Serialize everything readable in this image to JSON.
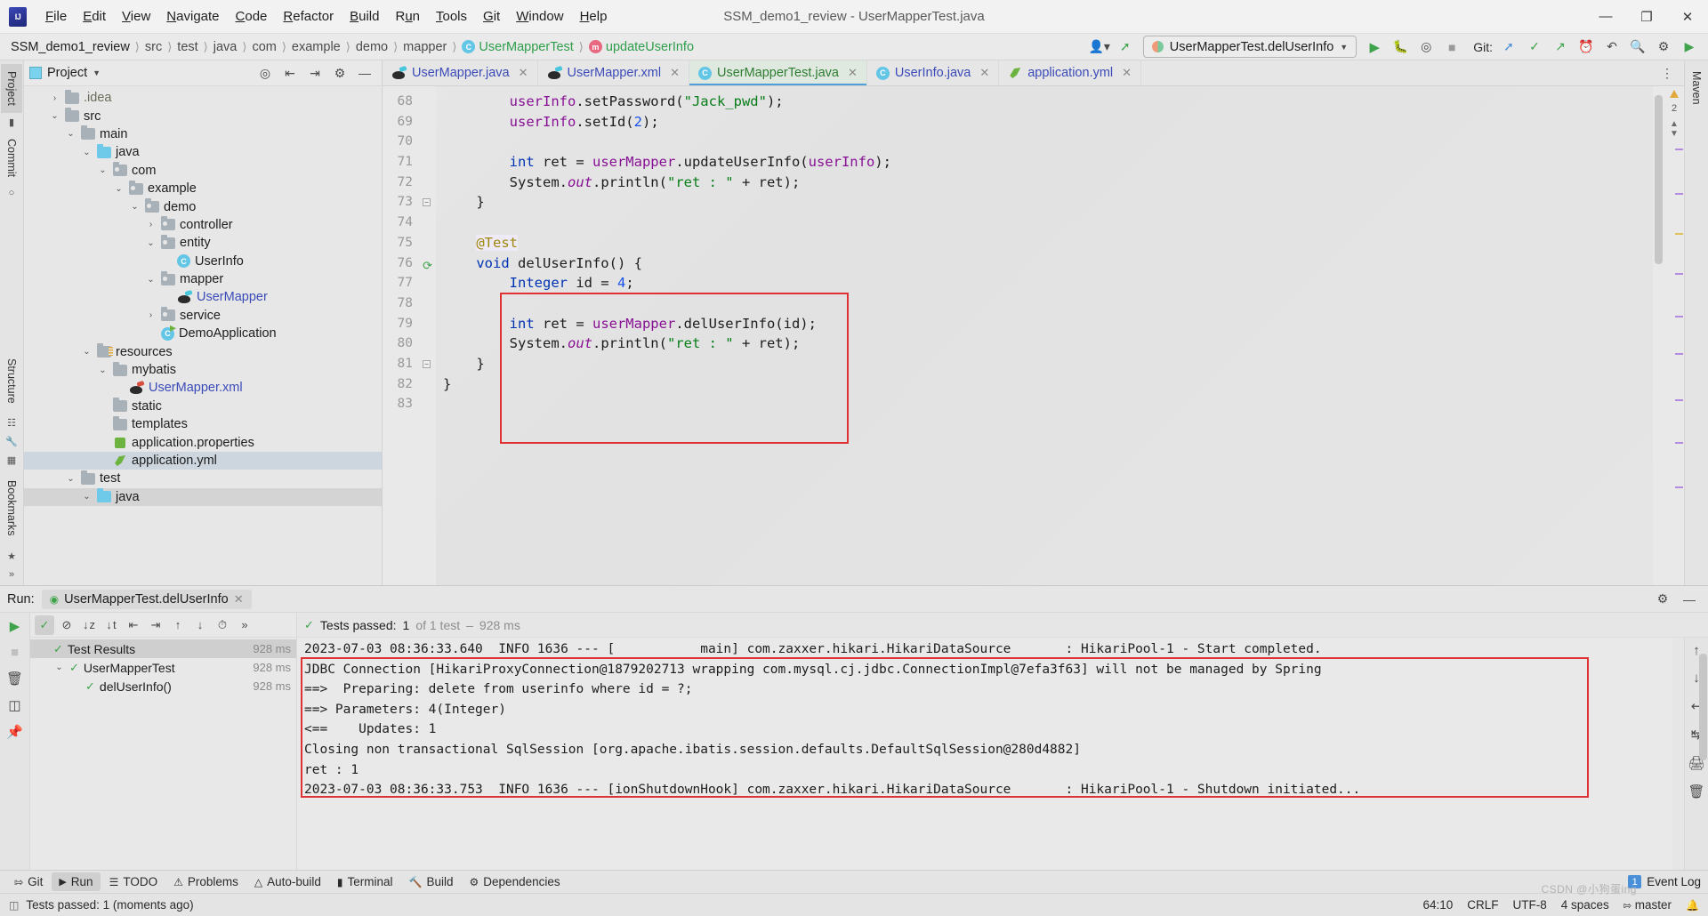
{
  "window": {
    "title": "SSM_demo1_review - UserMapperTest.java",
    "minimize": "—",
    "maximize": "❐",
    "close": "✕"
  },
  "menu": {
    "items": [
      "File",
      "Edit",
      "View",
      "Navigate",
      "Code",
      "Refactor",
      "Build",
      "Run",
      "Tools",
      "Git",
      "Window",
      "Help"
    ]
  },
  "breadcrumb": {
    "items": [
      {
        "label": "SSM_demo1_review",
        "type": "project"
      },
      {
        "label": "src",
        "type": "dir"
      },
      {
        "label": "test",
        "type": "dir"
      },
      {
        "label": "java",
        "type": "dir"
      },
      {
        "label": "com",
        "type": "dir"
      },
      {
        "label": "example",
        "type": "dir"
      },
      {
        "label": "demo",
        "type": "dir"
      },
      {
        "label": "mapper",
        "type": "dir"
      },
      {
        "label": "UserMapperTest",
        "type": "class"
      },
      {
        "label": "updateUserInfo",
        "type": "method"
      }
    ]
  },
  "toolbar": {
    "run_config": "UserMapperTest.delUserInfo",
    "git_label": "Git:",
    "icons": {
      "profile": "person-icon",
      "updown": "arrow-icon",
      "run": "run-icon",
      "debug": "debug-icon",
      "coverage": "coverage-icon",
      "stop": "stop-icon",
      "commit": "commit-icon",
      "check": "check-icon",
      "push": "push-icon",
      "history": "history-icon",
      "undo": "undo-icon",
      "search": "search-icon",
      "settings": "settings-icon"
    }
  },
  "left_rail": {
    "tabs": [
      "Project",
      "Commit"
    ],
    "bottom": [
      "Structure",
      "Bookmarks"
    ]
  },
  "project_panel": {
    "title": "Project",
    "tree": [
      {
        "label": ".idea",
        "depth": 1,
        "twisty": "›",
        "icon": "folder",
        "style": "dim"
      },
      {
        "label": "src",
        "depth": 1,
        "twisty": "⌄",
        "icon": "folder",
        "style": ""
      },
      {
        "label": "main",
        "depth": 2,
        "twisty": "⌄",
        "icon": "folder",
        "style": ""
      },
      {
        "label": "java",
        "depth": 3,
        "twisty": "⌄",
        "icon": "folder-blue",
        "style": ""
      },
      {
        "label": "com",
        "depth": 4,
        "twisty": "⌄",
        "icon": "folder-pkg",
        "style": ""
      },
      {
        "label": "example",
        "depth": 5,
        "twisty": "⌄",
        "icon": "folder-pkg",
        "style": ""
      },
      {
        "label": "demo",
        "depth": 6,
        "twisty": "⌄",
        "icon": "folder-pkg",
        "style": ""
      },
      {
        "label": "controller",
        "depth": 7,
        "twisty": "›",
        "icon": "folder-pkg",
        "style": ""
      },
      {
        "label": "entity",
        "depth": 7,
        "twisty": "⌄",
        "icon": "folder-pkg",
        "style": ""
      },
      {
        "label": "UserInfo",
        "depth": 8,
        "twisty": "",
        "icon": "class",
        "style": ""
      },
      {
        "label": "mapper",
        "depth": 7,
        "twisty": "⌄",
        "icon": "folder-pkg",
        "style": ""
      },
      {
        "label": "UserMapper",
        "depth": 8,
        "twisty": "",
        "icon": "mybatis",
        "style": "link"
      },
      {
        "label": "service",
        "depth": 7,
        "twisty": "›",
        "icon": "folder-pkg",
        "style": ""
      },
      {
        "label": "DemoApplication",
        "depth": 7,
        "twisty": "",
        "icon": "spring-class",
        "style": ""
      },
      {
        "label": "resources",
        "depth": 3,
        "twisty": "⌄",
        "icon": "folder-res",
        "style": ""
      },
      {
        "label": "mybatis",
        "depth": 4,
        "twisty": "⌄",
        "icon": "folder",
        "style": ""
      },
      {
        "label": "UserMapper.xml",
        "depth": 5,
        "twisty": "",
        "icon": "mybatis-red",
        "style": "link"
      },
      {
        "label": "static",
        "depth": 4,
        "twisty": "",
        "icon": "folder",
        "style": ""
      },
      {
        "label": "templates",
        "depth": 4,
        "twisty": "",
        "icon": "folder",
        "style": ""
      },
      {
        "label": "application.properties",
        "depth": 4,
        "twisty": "",
        "icon": "props",
        "style": ""
      },
      {
        "label": "application.yml",
        "depth": 4,
        "twisty": "",
        "icon": "yml",
        "style": "selected"
      },
      {
        "label": "test",
        "depth": 2,
        "twisty": "⌄",
        "icon": "folder",
        "style": ""
      },
      {
        "label": "java",
        "depth": 3,
        "twisty": "⌄",
        "icon": "folder-blue",
        "style": "selected2"
      }
    ]
  },
  "editor": {
    "tabs": [
      {
        "label": "UserMapper.java",
        "icon": "mybatis-icon",
        "active": false
      },
      {
        "label": "UserMapper.xml",
        "icon": "mybatis-icon",
        "active": false
      },
      {
        "label": "UserMapperTest.java",
        "icon": "class-icon",
        "active": true
      },
      {
        "label": "UserInfo.java",
        "icon": "class-icon",
        "active": false
      },
      {
        "label": "application.yml",
        "icon": "yml-icon",
        "active": false
      }
    ],
    "warning_count": "2",
    "line_numbers": [
      "68",
      "69",
      "70",
      "71",
      "72",
      "73",
      "74",
      "75",
      "76",
      "77",
      "78",
      "79",
      "80",
      "81",
      "82",
      "83"
    ],
    "lines": [
      "        userInfo.setPassword(\"Jack_pwd\");",
      "        userInfo.setId(2);",
      "",
      "        int ret = userMapper.updateUserInfo(userInfo);",
      "        System.out.println(\"ret : \" + ret);",
      "    }",
      "",
      "    @Test",
      "    void delUserInfo() {",
      "        Integer id = 4;",
      "",
      "        int ret = userMapper.delUserInfo(id);",
      "        System.out.println(\"ret : \" + ret);",
      "    }",
      "}",
      ""
    ],
    "highlight_color": "#e03232"
  },
  "run_panel": {
    "run_label": "Run:",
    "tab_label": "UserMapperTest.delUserInfo",
    "tests_toolbar_icons": [
      "rerun-icon",
      "rerun-failed-icon",
      "sort-alpha-icon",
      "sort-duration-icon",
      "expand-all-icon",
      "collapse-all-icon",
      "prev-icon",
      "next-icon",
      "history-icon",
      "more-icon"
    ],
    "status": {
      "prefix": "Tests passed:",
      "count": "1",
      "suffix": "of 1 test",
      "duration": "928 ms"
    },
    "tree": [
      {
        "label": "Test Results",
        "depth": 0,
        "dur": "928 ms",
        "twisty": "",
        "kind": "root"
      },
      {
        "label": "UserMapperTest",
        "depth": 1,
        "dur": "928 ms",
        "twisty": "⌄",
        "kind": "class"
      },
      {
        "label": "delUserInfo()",
        "depth": 2,
        "dur": "928 ms",
        "twisty": "",
        "kind": "method"
      }
    ],
    "console_gutter": [
      "928 ms",
      "928 ms",
      "",
      "",
      "",
      "",
      ""
    ],
    "console": [
      "2023-07-03 08:36:33.640  INFO 1636 --- [           main] com.zaxxer.hikari.HikariDataSource       : HikariPool-1 - Start completed.",
      "JDBC Connection [HikariProxyConnection@1879202713 wrapping com.mysql.cj.jdbc.ConnectionImpl@7efa3f63] will not be managed by Spring",
      "==>  Preparing: delete from userinfo where id = ?;",
      "==> Parameters: 4(Integer)",
      "<==    Updates: 1",
      "Closing non transactional SqlSession [org.apache.ibatis.session.defaults.DefaultSqlSession@280d4882]",
      "ret : 1",
      "2023-07-03 08:36:33.753  INFO 1636 --- [ionShutdownHook] com.zaxxer.hikari.HikariDataSource       : HikariPool-1 - Shutdown initiated..."
    ],
    "highlight_color": "#e03232"
  },
  "tool_window_bar": {
    "items": [
      {
        "label": "Git",
        "icon": "branch-icon",
        "active": false
      },
      {
        "label": "Run",
        "icon": "run-icon",
        "active": true
      },
      {
        "label": "TODO",
        "icon": "list-icon",
        "active": false
      },
      {
        "label": "Problems",
        "icon": "warning-icon",
        "active": false
      },
      {
        "label": "Auto-build",
        "icon": "build-icon",
        "active": false
      },
      {
        "label": "Terminal",
        "icon": "terminal-icon",
        "active": false
      },
      {
        "label": "Build",
        "icon": "hammer-icon",
        "active": false
      },
      {
        "label": "Dependencies",
        "icon": "deps-icon",
        "active": false
      }
    ],
    "event_log": {
      "count": "1",
      "label": "Event Log"
    }
  },
  "status_bar": {
    "message": "Tests passed: 1 (moments ago)",
    "caret": "64:10",
    "line_sep": "CRLF",
    "encoding": "UTF-8",
    "indent": "4 spaces",
    "branch": "master"
  },
  "watermark": "CSDN @小狗蛋ing",
  "right_rail": {
    "tabs": [
      "Maven"
    ]
  }
}
